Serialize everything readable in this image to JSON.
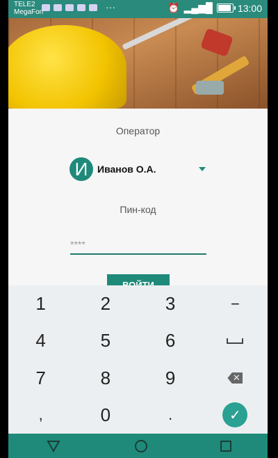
{
  "status_bar": {
    "carrier_1": "TELE2",
    "carrier_2": "MegaFon",
    "overflow": "···",
    "time": "13:00",
    "icons": [
      "camera-icon",
      "gallery-icon",
      "app-icon",
      "mail-icon",
      "message-icon",
      "alarm-icon",
      "signal-icon",
      "battery-icon"
    ]
  },
  "form": {
    "operator_label": "Оператор",
    "operator_initial": "И",
    "operator_name": "Иванов О.А.",
    "pin_label": "Пин-код",
    "pin_placeholder": "****",
    "pin_value": "",
    "login_button": "ВОЙТИ"
  },
  "keypad": {
    "keys": [
      "1",
      "2",
      "3",
      "−",
      "4",
      "5",
      "6",
      "space",
      "7",
      "8",
      "9",
      "backspace",
      ",",
      "0",
      ".",
      "done"
    ]
  },
  "colors": {
    "accent": "#1f8a7a",
    "status_bar": "#2a8a7c",
    "keypad_bg": "#eceff1"
  }
}
